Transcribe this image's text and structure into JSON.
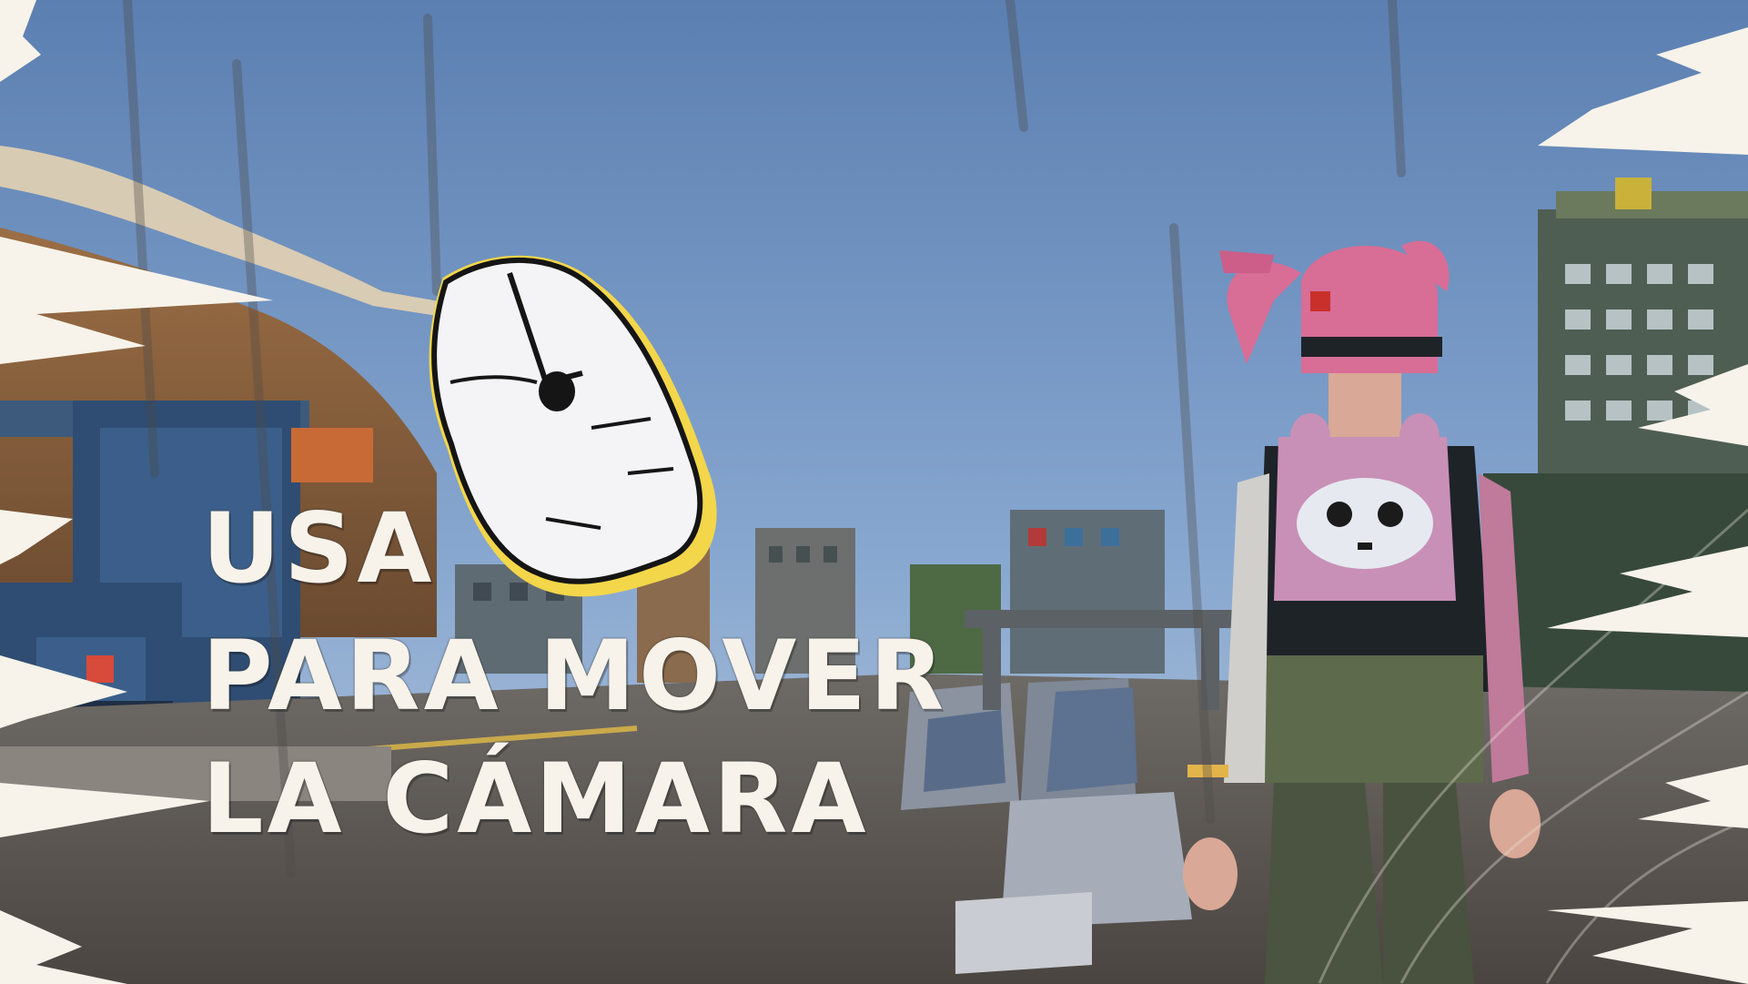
{
  "tutorial": {
    "line1": "USA",
    "line2": "PARA MOVER",
    "line3": "LA CÁMARA"
  },
  "icons": {
    "input_icon": "computer-mouse-icon"
  },
  "colors": {
    "sky": "#6f91bd",
    "text": "#f7f3ea",
    "mouse_outline": "#f3d64a",
    "hair": "#d86d96",
    "torn_paper": "#f7f3ea"
  }
}
